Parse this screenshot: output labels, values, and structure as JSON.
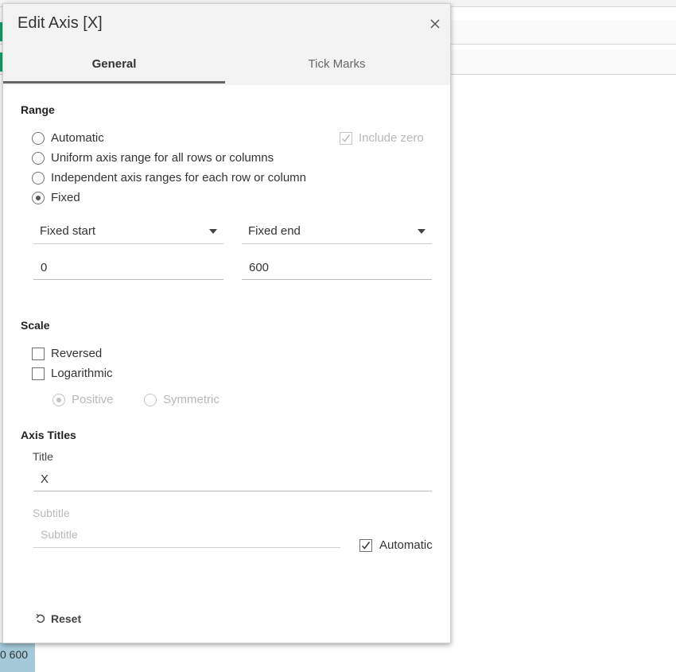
{
  "background": {
    "axis_label": "0  600"
  },
  "dialog": {
    "title": "Edit Axis [X]",
    "tabs": [
      {
        "label": "General",
        "active": true
      },
      {
        "label": "Tick Marks",
        "active": false
      }
    ],
    "range": {
      "section_title": "Range",
      "options": [
        {
          "label": "Automatic",
          "checked": false
        },
        {
          "label": "Uniform axis range for all rows or columns",
          "checked": false
        },
        {
          "label": "Independent axis ranges for each row or column",
          "checked": false
        },
        {
          "label": "Fixed",
          "checked": true
        }
      ],
      "include_zero": {
        "label": "Include zero",
        "checked": true,
        "disabled": true
      },
      "start_dropdown": "Fixed start",
      "end_dropdown": "Fixed end",
      "start_value": "0",
      "end_value": "600"
    },
    "scale": {
      "section_title": "Scale",
      "reversed": {
        "label": "Reversed",
        "checked": false
      },
      "logarithmic": {
        "label": "Logarithmic",
        "checked": false
      },
      "positive": {
        "label": "Positive",
        "checked": true,
        "disabled": true
      },
      "symmetric": {
        "label": "Symmetric",
        "checked": false,
        "disabled": true
      }
    },
    "axis_titles": {
      "section_title": "Axis Titles",
      "title_label": "Title",
      "title_value": "X",
      "subtitle_label": "Subtitle",
      "subtitle_placeholder": "Subtitle",
      "automatic": {
        "label": "Automatic",
        "checked": true
      }
    },
    "reset_label": "Reset"
  }
}
